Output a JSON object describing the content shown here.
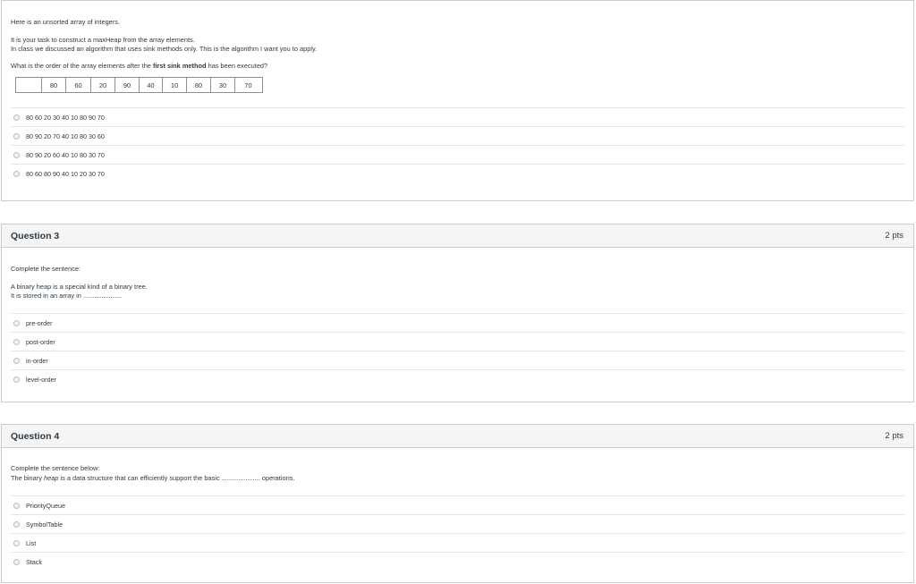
{
  "q2": {
    "intro": "Here is an unsorted array of integers.",
    "task": "It is your task to construct a maxHeap from the array elements.",
    "algo": "In class we discussed an algorithm that uses sink methods only. This is the algorithm I want you to apply.",
    "question_pre": "What is the order of the array elements after the ",
    "question_bold": "first sink method",
    "question_post": " has been executed?",
    "array": [
      "",
      "80",
      "60",
      "20",
      "90",
      "40",
      "10",
      "80",
      "30",
      "70"
    ],
    "answers": [
      "80 60 20 30 40 10 80 90 70",
      "80 90 20 70 40 10 80 30 60",
      "80 90 20 60 40 10 80 30 70",
      "80 60 80 90 40 10 20 30 70"
    ]
  },
  "q3": {
    "title": "Question 3",
    "points": "2 pts",
    "prompt": "Complete the sentence:",
    "line1": "A binary heap is a special kind of a binary tree.",
    "line2": "It is stored in an array in .....................",
    "answers": [
      "pre-order",
      "post-order",
      "in-order",
      "level-order"
    ]
  },
  "q4": {
    "title": "Question 4",
    "points": "2 pts",
    "prompt": "Complete the sentence below:",
    "sentence_pre": "The binary ",
    "sentence_bold": "heap",
    "sentence_post": " is a data structure that can efficiently support the basic ..................... operations.",
    "answers": [
      "PriorityQueue",
      "SymbolTable",
      "List",
      "Stack"
    ]
  }
}
